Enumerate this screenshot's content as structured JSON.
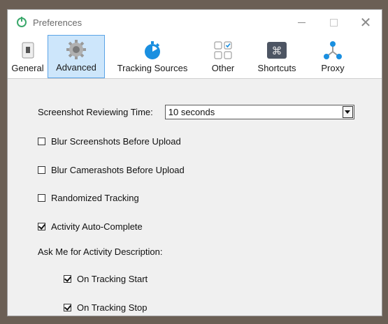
{
  "window": {
    "title": "Preferences",
    "close_glyph": "✕"
  },
  "tabs": [
    {
      "label": "General",
      "icon": "phone-icon"
    },
    {
      "label": "Advanced",
      "icon": "gear-icon",
      "active": true
    },
    {
      "label": "Tracking Sources",
      "icon": "stopwatch-icon"
    },
    {
      "label": "Other",
      "icon": "grid-check-icon"
    },
    {
      "label": "Shortcuts",
      "icon": "command-key-icon"
    },
    {
      "label": "Proxy",
      "icon": "network-icon"
    }
  ],
  "advanced": {
    "screenshot_time_label": "Screenshot Reviewing Time:",
    "screenshot_time_value": "10 seconds",
    "options": [
      {
        "label": "Blur Screenshots Before Upload",
        "checked": false
      },
      {
        "label": "Blur Camerashots Before Upload",
        "checked": false
      },
      {
        "label": "Randomized Tracking",
        "checked": false
      },
      {
        "label": "Activity Auto-Complete",
        "checked": true
      }
    ],
    "ask_label": "Ask Me for Activity Description:",
    "ask_options": [
      {
        "label": "On Tracking Start",
        "checked": true
      },
      {
        "label": "On Tracking Stop",
        "checked": true
      }
    ]
  },
  "colors": {
    "accent": "#1a8fe0",
    "active_tab_bg": "#cde6fb",
    "active_tab_border": "#5aa3e6",
    "app_icon": "#3aa86b"
  }
}
